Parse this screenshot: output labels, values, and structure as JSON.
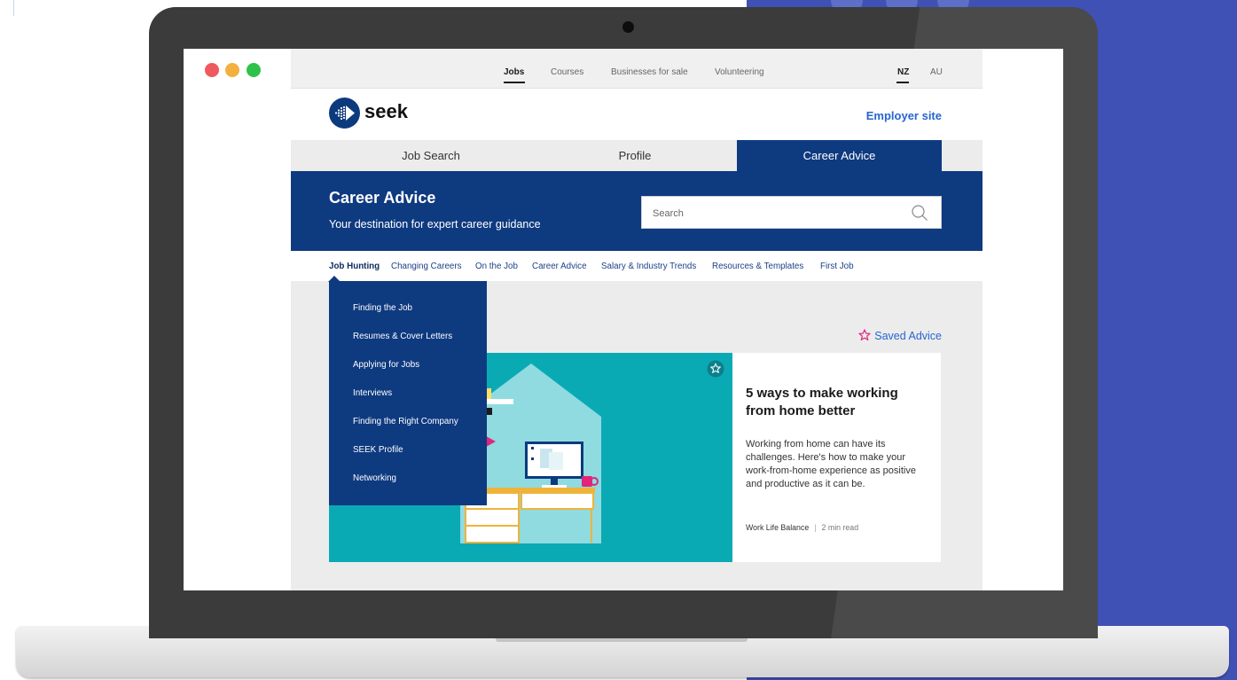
{
  "browser": {
    "top_nav": [
      "Jobs",
      "Courses",
      "Businesses for sale",
      "Volunteering"
    ],
    "locales": [
      "NZ",
      "AU"
    ]
  },
  "site": {
    "logo_text": "seek",
    "employer_link": "Employer site",
    "tabs": [
      "Job Search",
      "Profile",
      "Career Advice"
    ],
    "active_tab": "Career Advice",
    "banner": {
      "title": "Career Advice",
      "subtitle": "Your destination for expert career guidance"
    },
    "search": {
      "placeholder": "Search",
      "value": ""
    },
    "subnav": [
      "Job Hunting",
      "Changing Careers",
      "On the Job",
      "Career Advice",
      "Salary & Industry Trends",
      "Resources & Templates",
      "First Job"
    ],
    "active_subnav": "Job Hunting",
    "dropdown": [
      "Finding the Job",
      "Resumes & Cover Letters",
      "Applying for Jobs",
      "Interviews",
      "Finding the Right Company",
      "SEEK Profile",
      "Networking"
    ],
    "saved_advice": "Saved Advice",
    "article": {
      "title": "5 ways to make working from home better",
      "description": "Working from home can have its challenges. Here's how to make your work-from-home experience as positive and productive as it can be.",
      "category": "Work Life Balance",
      "separator": "|",
      "read_time": "2 min read"
    }
  },
  "colors": {
    "brand_navy": "#0e3a80",
    "link_blue": "#2765cf",
    "illustration_teal": "#0aaab5",
    "star_pink": "#e0257a",
    "background_blue": "#3f51b5"
  },
  "icons": {
    "search": "search-icon",
    "saved": "star-outline-icon",
    "bookmark": "bookmark-star-icon"
  }
}
